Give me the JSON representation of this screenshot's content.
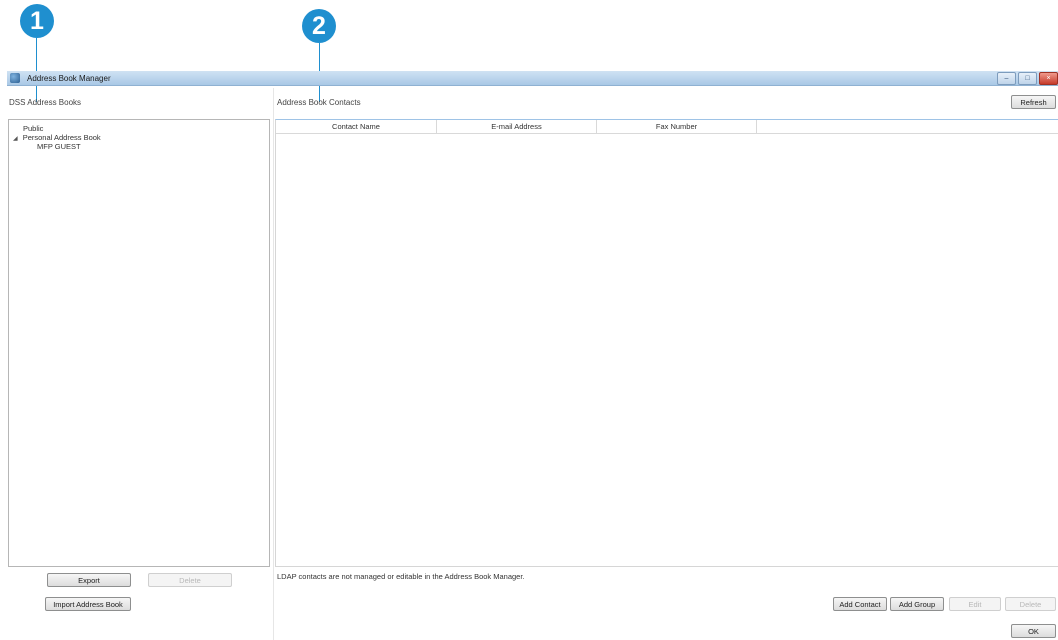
{
  "callouts": {
    "first": "1",
    "second": "2"
  },
  "window": {
    "title": "Address Book Manager",
    "icon": "app-icon"
  },
  "left_panel": {
    "title": "DSS Address Books",
    "tree": [
      {
        "label": "Public"
      },
      {
        "label": "Personal Address Book",
        "expander": "◢"
      },
      {
        "label": "MFP GUEST"
      }
    ],
    "export_label": "Export",
    "delete_label": "Delete",
    "import_label": "Import Address Book"
  },
  "right_panel": {
    "title": "Address Book Contacts",
    "refresh_label": "Refresh",
    "columns": [
      "Contact Name",
      "E-mail Address",
      "Fax Number"
    ],
    "note": "LDAP contacts are not managed or editable in the Address Book Manager.",
    "add_contact_label": "Add Contact",
    "add_group_label": "Add Group",
    "edit_label": "Edit",
    "delete_label": "Delete",
    "ok_label": "OK"
  },
  "colors": {
    "callout": "#1f8fcf",
    "titlebar": "#a9c8e6"
  }
}
